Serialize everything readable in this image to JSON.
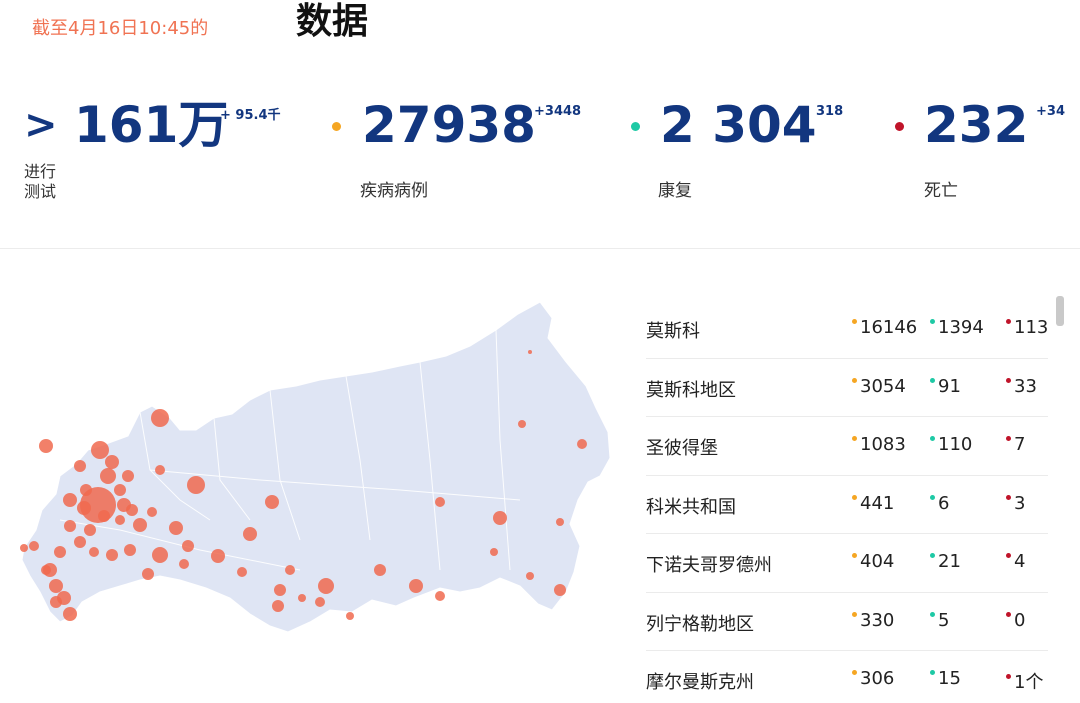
{
  "header": {
    "date_text": "截至4月16日10:45的",
    "title": "数据"
  },
  "stats": {
    "tests": {
      "marker": ">",
      "value": "161万",
      "delta": "+ 95.4千",
      "label_line1": "进行",
      "label_line2": "测试"
    },
    "cases": {
      "value": "27938",
      "delta": "+3448",
      "label": "疾病病例",
      "color": "#f5a623"
    },
    "recovered": {
      "value": "2 304",
      "delta": "318",
      "label": "康复",
      "color": "#1ec9a5"
    },
    "deaths": {
      "value": "232",
      "delta": "+34",
      "label": "死亡",
      "color": "#c0142a"
    }
  },
  "colors": {
    "accent_orange": "#f07353",
    "number_blue": "#12367f",
    "map_fill": "#dfe5f4",
    "bubble": "#f06a4f"
  },
  "regions": [
    {
      "name": "莫斯科",
      "cases": "16146",
      "recovered": "1394",
      "deaths": "113"
    },
    {
      "name": "莫斯科地区",
      "cases": "3054",
      "recovered": "91",
      "deaths": "33"
    },
    {
      "name": "圣彼得堡",
      "cases": "1083",
      "recovered": "110",
      "deaths": "7"
    },
    {
      "name": "科米共和国",
      "cases": "441",
      "recovered": "6",
      "deaths": "3"
    },
    {
      "name": "下诺夫哥罗德州",
      "cases": "404",
      "recovered": "21",
      "deaths": "4"
    },
    {
      "name": "列宁格勒地区",
      "cases": "330",
      "recovered": "5",
      "deaths": "0"
    },
    {
      "name": "摩尔曼斯克州",
      "cases": "306",
      "recovered": "15",
      "deaths": "1个"
    }
  ]
}
